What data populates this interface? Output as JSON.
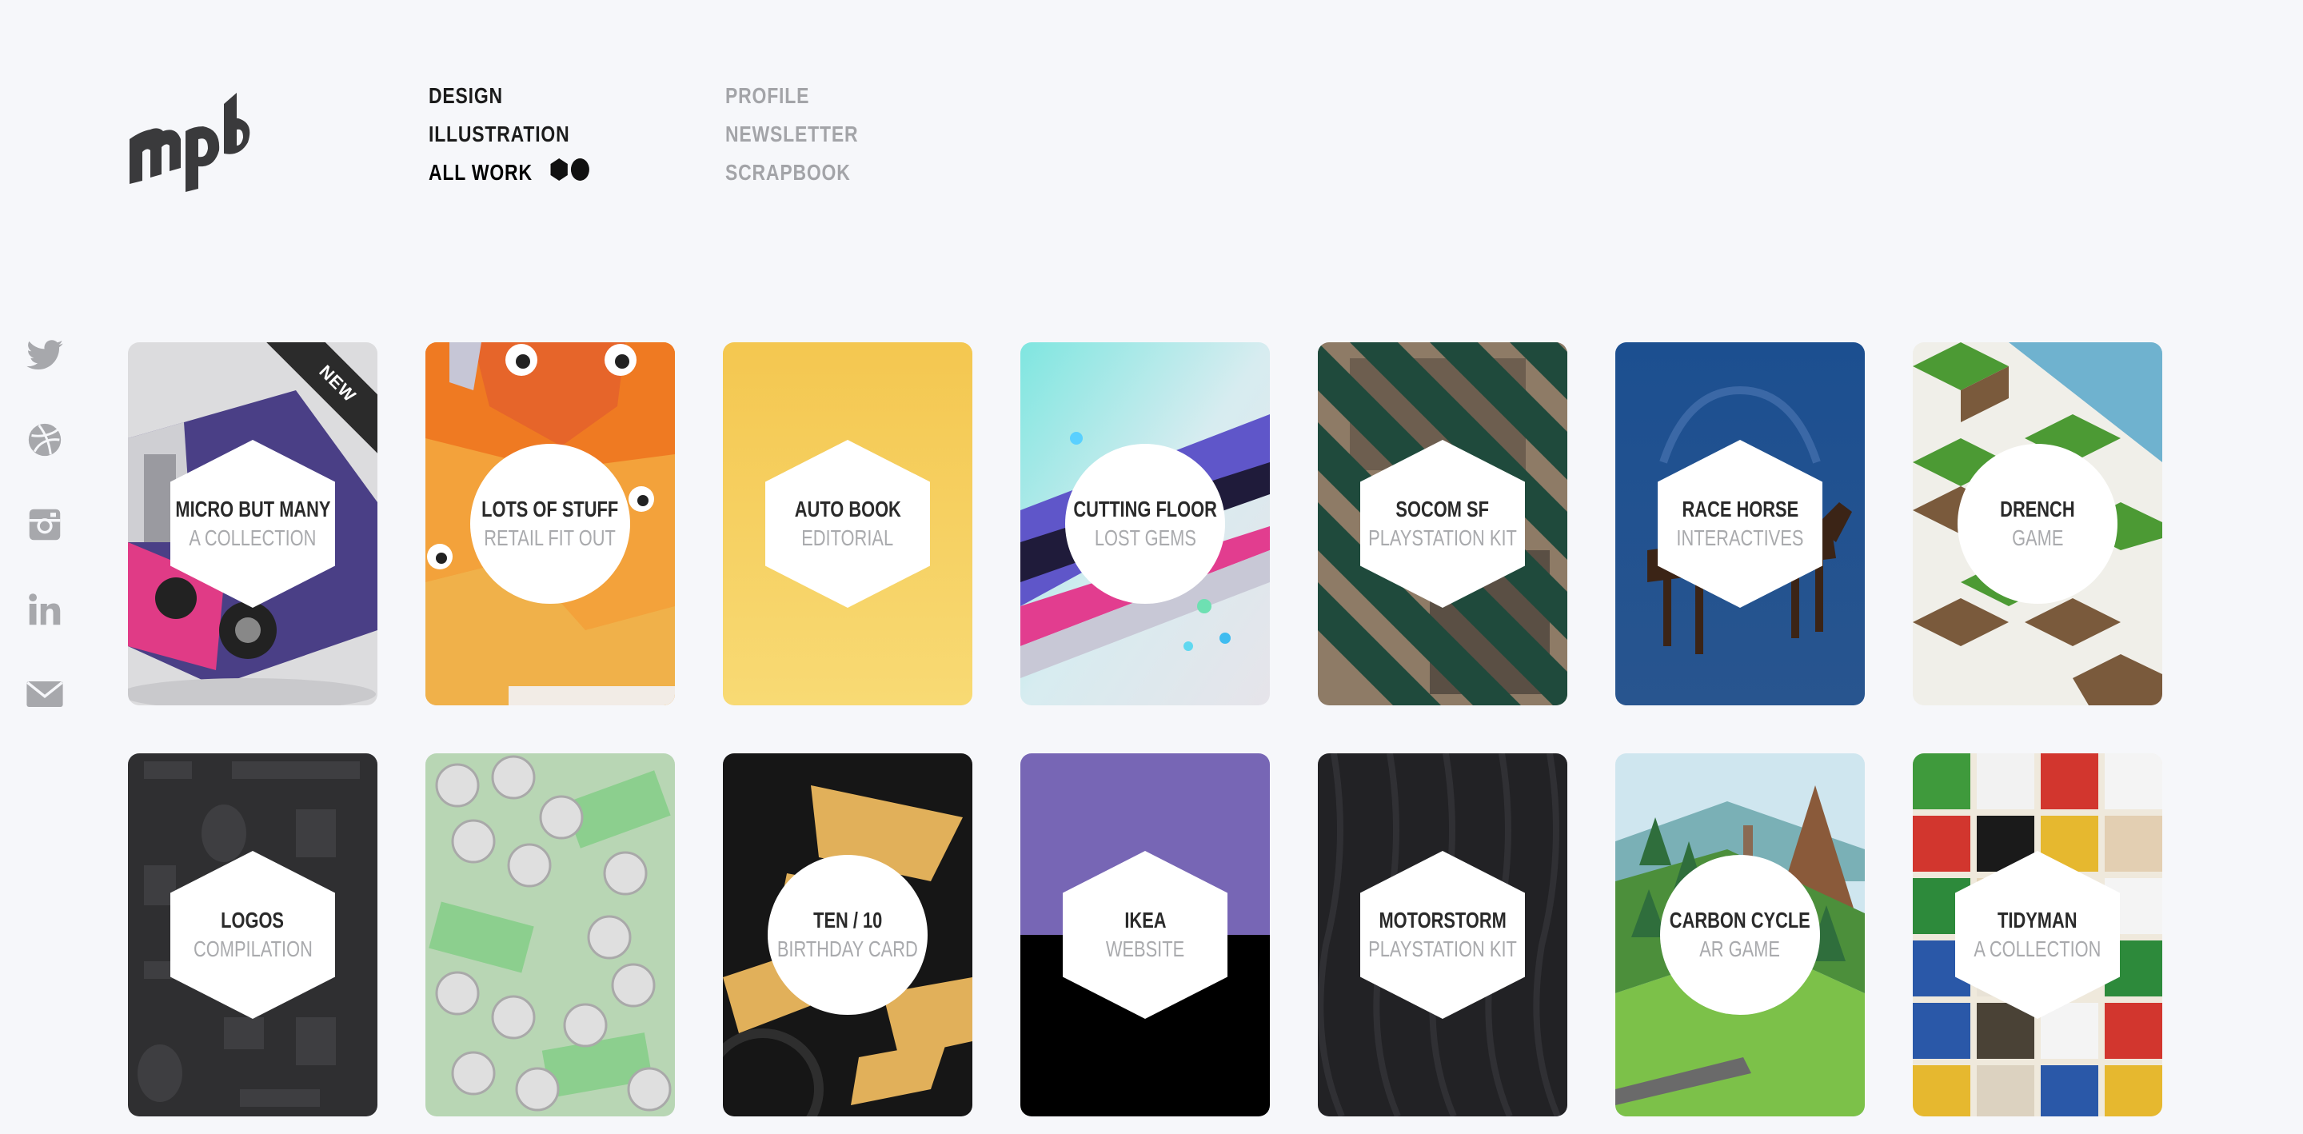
{
  "brand": {
    "logo_text": "mpb"
  },
  "nav": {
    "primary": [
      {
        "label": "DESIGN",
        "active": false
      },
      {
        "label": "ILLUSTRATION",
        "active": false
      },
      {
        "label": "ALL WORK",
        "active": true
      }
    ],
    "secondary": [
      {
        "label": "PROFILE"
      },
      {
        "label": "NEWSLETTER"
      },
      {
        "label": "SCRAPBOOK"
      }
    ]
  },
  "social": [
    "twitter-icon",
    "dribbble-icon",
    "instagram-icon",
    "linkedin-icon",
    "email-icon"
  ],
  "cards": [
    {
      "title": "MICRO BUT MANY",
      "subtitle": "A COLLECTION",
      "ribbon": "NEW",
      "color": "#d9dadd"
    },
    {
      "title": "LOTS OF STUFF",
      "subtitle": "RETAIL FIT OUT",
      "color": "#f09a35"
    },
    {
      "title": "AUTO BOOK",
      "subtitle": "EDITORIAL",
      "color": "#f5cc5a"
    },
    {
      "title": "CUTTING FLOOR",
      "subtitle": "LOST GEMS",
      "color": "#c9e7ea"
    },
    {
      "title": "SOCOM SF",
      "subtitle": "PLAYSTATION KIT",
      "color": "#1f4a3c"
    },
    {
      "title": "RACE HORSE",
      "subtitle": "INTERACTIVES",
      "color": "#1f4f8e"
    },
    {
      "title": "DRENCH",
      "subtitle": "GAME",
      "color": "#7db0c9"
    },
    {
      "title": "LOGOS",
      "subtitle": "COMPILATION",
      "color": "#2f2f31"
    },
    {
      "title": "",
      "subtitle": "",
      "color": "#c2d3c4"
    },
    {
      "title": "TEN / 10",
      "subtitle": "BIRTHDAY CARD",
      "color": "#1c1c1c"
    },
    {
      "title": "IKEA",
      "subtitle": "WEBSITE",
      "color": "#7766b5"
    },
    {
      "title": "MOTORSTORM",
      "subtitle": "PLAYSTATION KIT",
      "color": "#222225"
    },
    {
      "title": "CARBON CYCLE",
      "subtitle": "AR GAME",
      "color": "#9cc16a"
    },
    {
      "title": "TIDYMAN",
      "subtitle": "A COLLECTION",
      "color": "#e8e2d6"
    }
  ]
}
